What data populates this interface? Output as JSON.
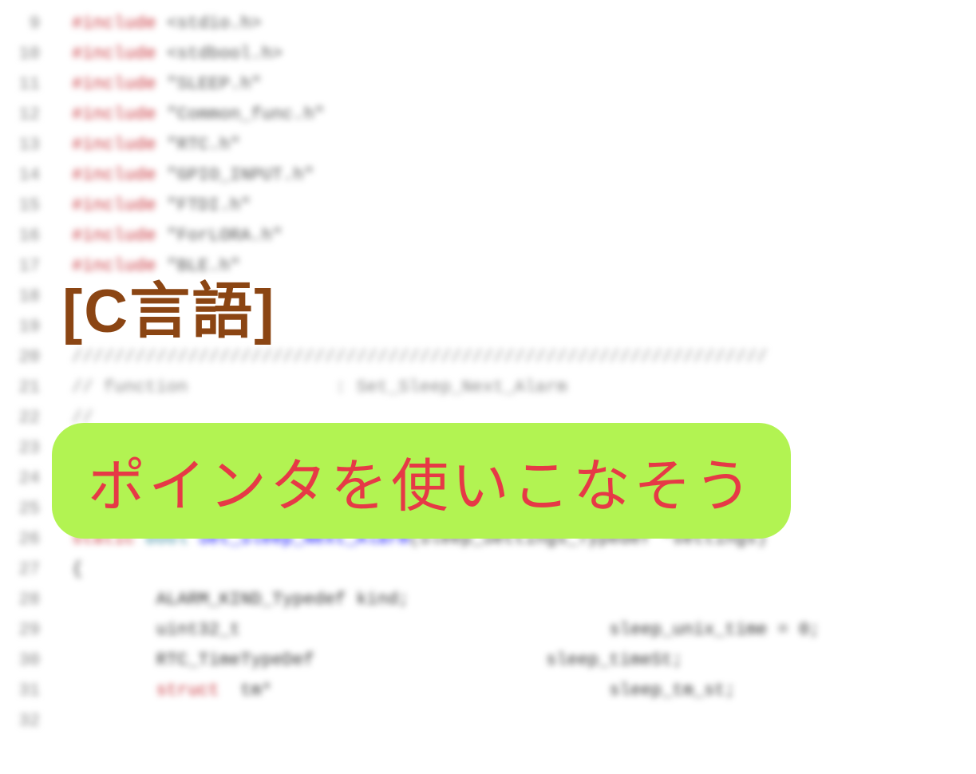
{
  "title_badge": "[C言語]",
  "subtitle_badge": "ポインタを使いこなそう",
  "code_lines": [
    {
      "num": "9",
      "include": "#include",
      "rest": " <stdio.h>"
    },
    {
      "num": "10",
      "include": "#include",
      "rest": " <stdbool.h>"
    },
    {
      "num": "11",
      "include": "#include",
      "rest": " \"SLEEP.h\""
    },
    {
      "num": "12",
      "include": "#include",
      "rest": " \"Common_func.h\""
    },
    {
      "num": "13",
      "include": "#include",
      "rest": " \"RTC.h\""
    },
    {
      "num": "14",
      "include": "#include",
      "rest": " \"GPIO_INPUT.h\""
    },
    {
      "num": "15",
      "include": "#include",
      "rest": " \"FTDI.h\""
    },
    {
      "num": "16",
      "include": "#include",
      "rest": " \"ForLORA.h\""
    },
    {
      "num": "17",
      "include": "#include",
      "rest": " \"BLE.h\""
    },
    {
      "num": "18",
      "include": "",
      "rest": ""
    },
    {
      "num": "19",
      "include": "",
      "rest": ""
    },
    {
      "num": "20",
      "include": "",
      "comment": "//////////////////////////////////////////////////////////////////"
    },
    {
      "num": "21",
      "include": "",
      "comment": "// function              : Set_Sleep_Next_Alarm"
    },
    {
      "num": "22",
      "include": "",
      "comment": "//"
    },
    {
      "num": "23",
      "include": "",
      "comment": "//"
    },
    {
      "num": "24",
      "include": "",
      "comment": "//"
    },
    {
      "num": "25",
      "include": "",
      "comment": "//////////////////////////////////////////////////////////////////"
    }
  ],
  "func_line": {
    "num": "26",
    "static": "static",
    "bool": " bool ",
    "func": "Set_Sleep_Next_Alarm",
    "params": "(Sleep_Settings_Typedef *settings)"
  },
  "brace_line": {
    "num": "27",
    "text": "{"
  },
  "body_lines": [
    {
      "num": "28",
      "indent": "        ",
      "type": "ALARM_KIND_Typedef",
      "rest": " kind;"
    },
    {
      "num": "29",
      "indent": "        ",
      "type": "uint32_t",
      "rest": "                                   sleep_unix_time = 0;"
    },
    {
      "num": "30",
      "indent": "        ",
      "type": "RTC_TimeTypeDef",
      "rest": "                      sleep_timeSt;"
    }
  ],
  "struct_line": {
    "num": "31",
    "indent": "        ",
    "struct": "struct",
    "tm": "  tm*",
    "rest": "                                sleep_tm_st;"
  },
  "empty_line": {
    "num": "32"
  }
}
